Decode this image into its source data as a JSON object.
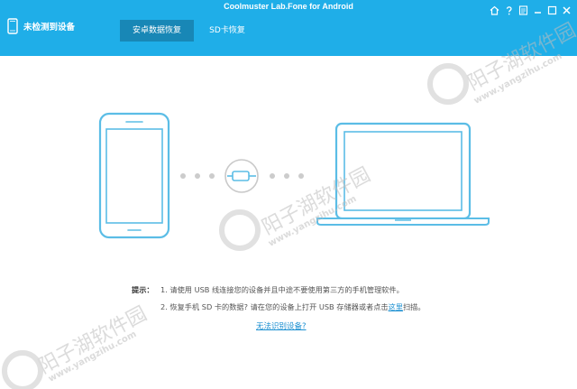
{
  "app": {
    "title": "Coolmuster Lab.Fone for Android"
  },
  "device": {
    "status": "未检测到设备"
  },
  "tabs": [
    {
      "label": "安卓数据恢复",
      "active": true
    },
    {
      "label": "SD卡恢复",
      "active": false
    }
  ],
  "window_controls": [
    "home-icon",
    "help-icon",
    "feedback-icon",
    "minimize-icon",
    "maximize-icon",
    "close-icon"
  ],
  "tips": {
    "label": "提示：",
    "line1": "1. 请使用 USB 线连接您的设备并且中途不要使用第三方的手机管理软件。",
    "line2_prefix": "2. 恢复手机 SD 卡的数据? 请在您的设备上打开 USB 存储器或者点击",
    "line2_link": "这里",
    "line2_suffix": "扫描。"
  },
  "help_link": "无法识别设备?",
  "watermark": {
    "text": "阳子湖软件园",
    "url": "www.yangzihu.com"
  },
  "colors": {
    "header": "#1faee8",
    "active_tab": "#1887b6",
    "link": "#1a8fd1",
    "device_line": "#5bbde6"
  }
}
